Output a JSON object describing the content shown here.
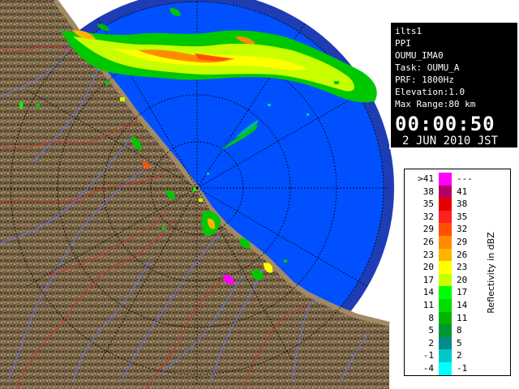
{
  "info": {
    "radar": "ilts1",
    "scan_type": "PPI",
    "product": "OUMU_IMA0",
    "task": "Task: OUMU_A",
    "prf": "PRF: 1800Hz",
    "elevation": "Elevation:1.0",
    "max_range": "Max Range:80 km",
    "time": "00:00:50",
    "date": "2 JUN 2010 JST"
  },
  "legend": {
    "title": "Reflectivity in dBZ",
    "rows": [
      {
        "lo": ">41",
        "hi": "---",
        "color": "#ff00ff"
      },
      {
        "lo": "38",
        "hi": "41",
        "color": "#b40064"
      },
      {
        "lo": "35",
        "hi": "38",
        "color": "#e60000"
      },
      {
        "lo": "32",
        "hi": "35",
        "color": "#ff2020"
      },
      {
        "lo": "29",
        "hi": "32",
        "color": "#ff5000"
      },
      {
        "lo": "26",
        "hi": "29",
        "color": "#ff8c00"
      },
      {
        "lo": "23",
        "hi": "26",
        "color": "#ffb400"
      },
      {
        "lo": "20",
        "hi": "23",
        "color": "#ffff00"
      },
      {
        "lo": "17",
        "hi": "20",
        "color": "#c8ff00"
      },
      {
        "lo": "14",
        "hi": "17",
        "color": "#00ff00"
      },
      {
        "lo": "11",
        "hi": "14",
        "color": "#00dc00"
      },
      {
        "lo": "8",
        "hi": "11",
        "color": "#00b400"
      },
      {
        "lo": "5",
        "hi": "8",
        "color": "#009632"
      },
      {
        "lo": "2",
        "hi": "5",
        "color": "#008c8c"
      },
      {
        "lo": "-1",
        "hi": "2",
        "color": "#00c8c8"
      },
      {
        "lo": "-4",
        "hi": "-1",
        "color": "#00ffff"
      }
    ]
  },
  "map": {
    "radar_coverage_color": "#0050ff",
    "outer_ring_color": "#1e3cb4",
    "background_color": "#ffffff",
    "terrain_color": "#7a6648"
  }
}
